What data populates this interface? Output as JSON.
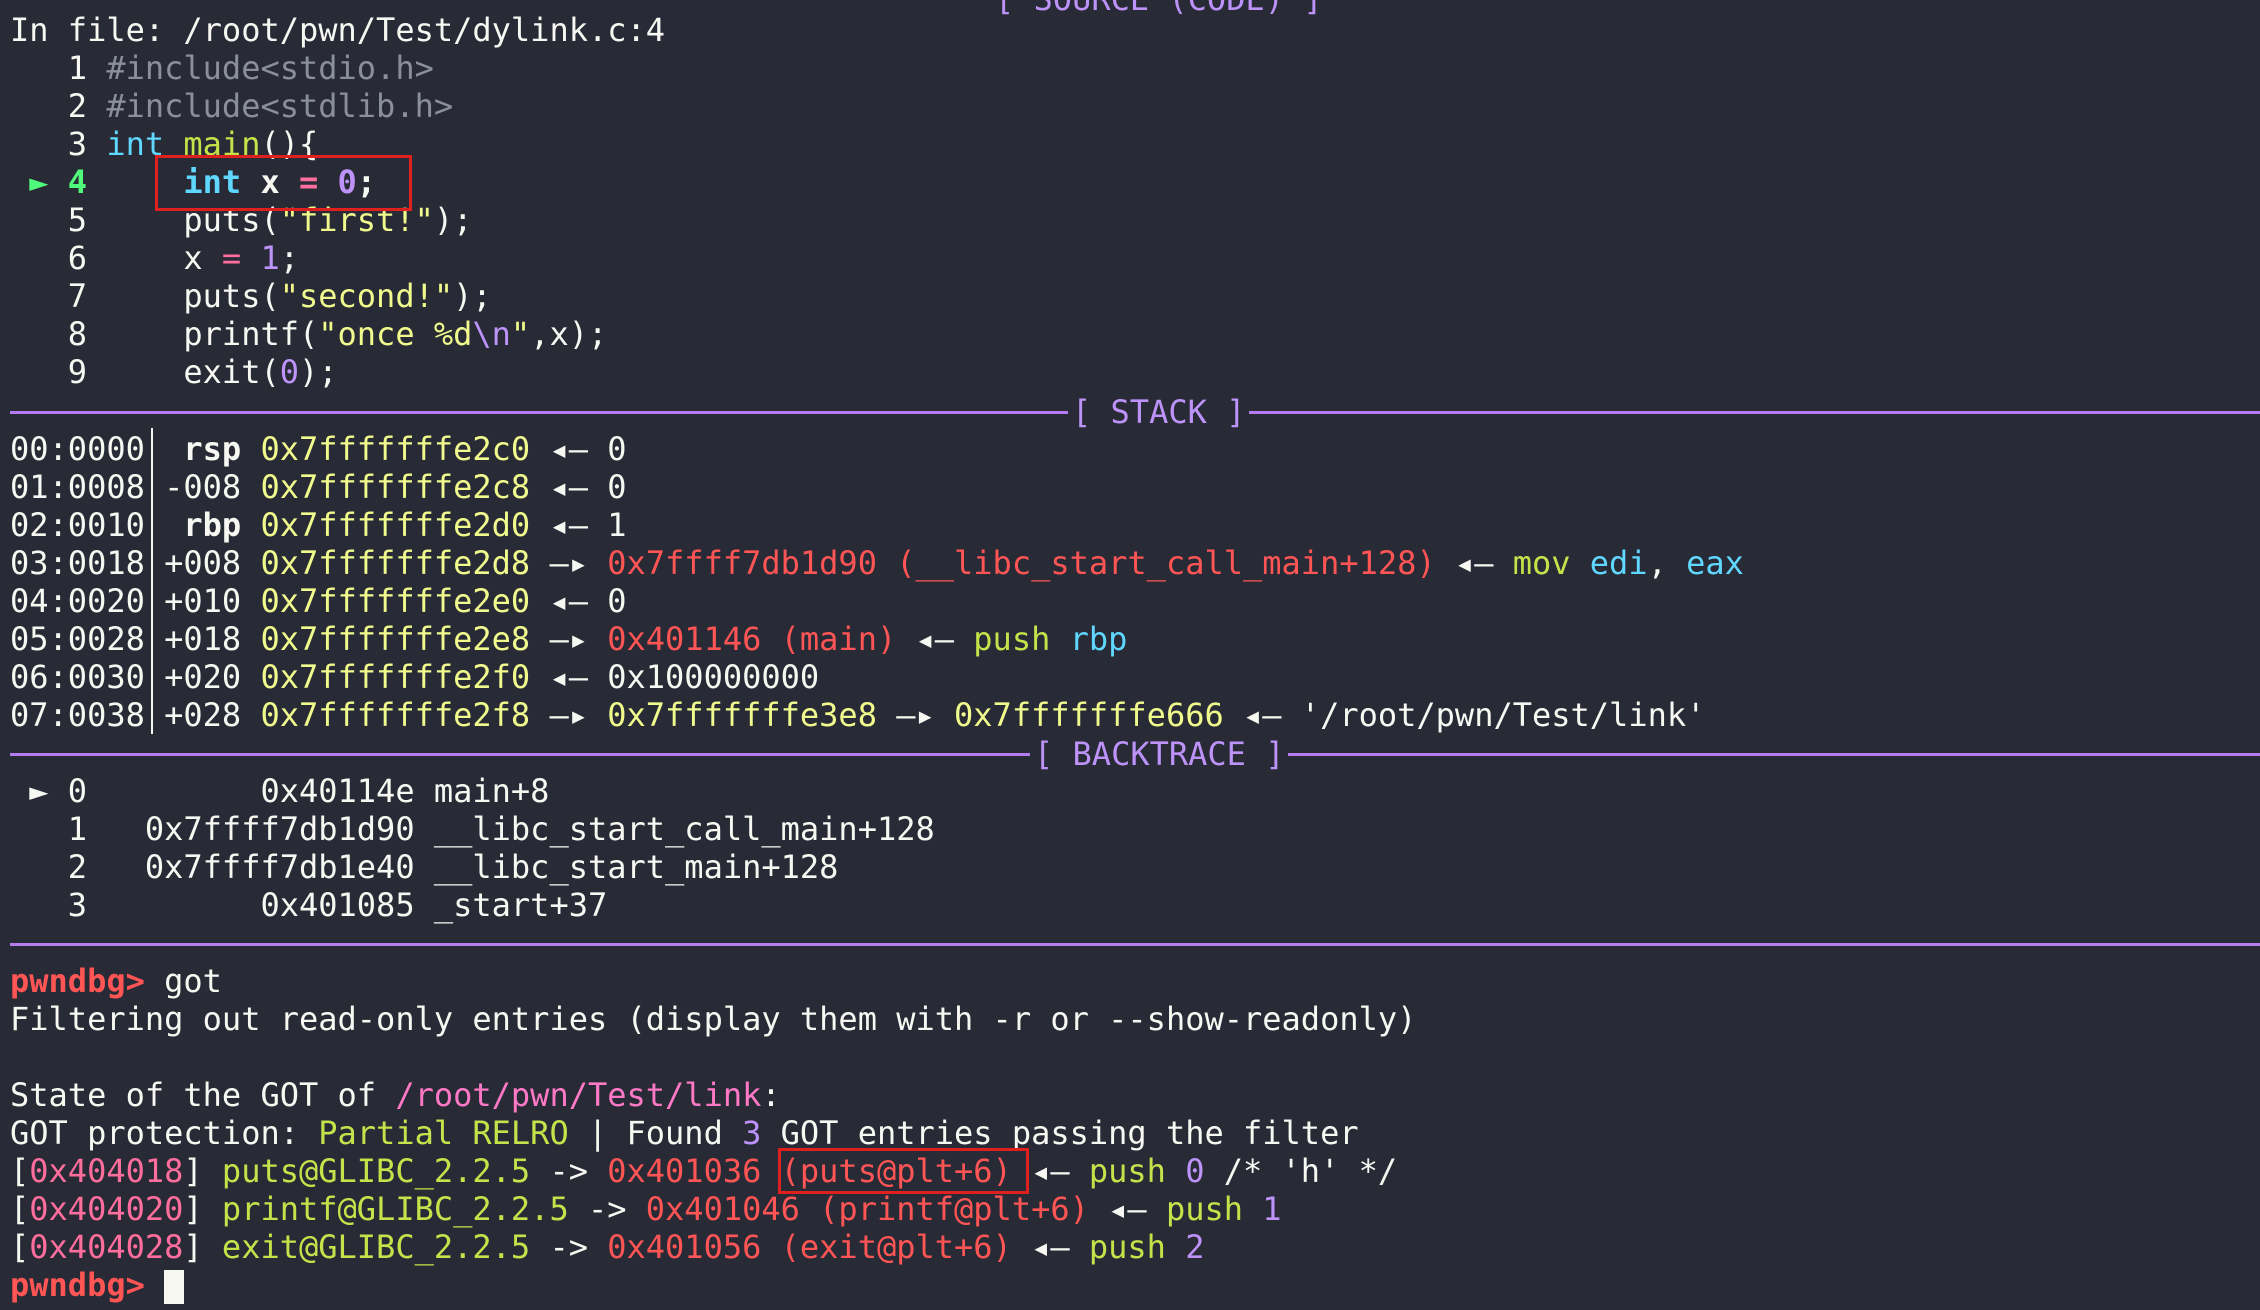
{
  "source": {
    "header_partial": "[ SOURCE (CODE) ]",
    "in_file": "In file: /root/pwn/Test/dylink.c:4",
    "lines": [
      {
        "num": "1",
        "code": "#include<stdio.h>"
      },
      {
        "num": "2",
        "code": "#include<stdlib.h>"
      },
      {
        "num": "3",
        "kw": "int",
        "fn": "main",
        "rest": "(){"
      },
      {
        "num": "4",
        "marker": "►",
        "kw": "int",
        "var": " x ",
        "op": "=",
        "val": " 0",
        "end": ";"
      },
      {
        "num": "5",
        "call": "puts(",
        "str": "\"first!\"",
        "end": ");"
      },
      {
        "num": "6",
        "var": "x ",
        "op": "=",
        "val": " 1",
        "end": ";"
      },
      {
        "num": "7",
        "call": "puts(",
        "str": "\"second!\"",
        "end": ");"
      },
      {
        "num": "8",
        "call": "printf(",
        "str1": "\"once %d",
        "esc": "\\n",
        "str2": "\"",
        "end": ",x);"
      },
      {
        "num": "9",
        "call": "exit(",
        "val": "0",
        "end": ");"
      }
    ]
  },
  "stack": {
    "title": "[ STACK ]",
    "rows": [
      {
        "idx": "00:0000",
        "reg": "rsp",
        "addr": "0x7fffffffe2c0",
        "arrow": "◂—",
        "val": "0"
      },
      {
        "idx": "01:0008",
        "reg": "-008",
        "addr": "0x7fffffffe2c8",
        "arrow": "◂—",
        "val": "0"
      },
      {
        "idx": "02:0010",
        "reg": "rbp",
        "addr": "0x7fffffffe2d0",
        "arrow": "◂—",
        "val": "1"
      },
      {
        "idx": "03:0018",
        "reg": "+008",
        "addr": "0x7fffffffe2d8",
        "arrow": "—▸",
        "target": "0x7ffff7db1d90 (__libc_start_call_main+128)",
        "arrow2": "◂—",
        "ins": "mov",
        "ops1": "edi",
        "comma": ",",
        "ops2": "eax"
      },
      {
        "idx": "04:0020",
        "reg": "+010",
        "addr": "0x7fffffffe2e0",
        "arrow": "◂—",
        "val": "0"
      },
      {
        "idx": "05:0028",
        "reg": "+018",
        "addr": "0x7fffffffe2e8",
        "arrow": "—▸",
        "target": "0x401146 (main)",
        "arrow2": "◂—",
        "ins": "push",
        "ops1": "rbp"
      },
      {
        "idx": "06:0030",
        "reg": "+020",
        "addr": "0x7fffffffe2f0",
        "arrow": "◂—",
        "val": "0x100000000"
      },
      {
        "idx": "07:0038",
        "reg": "+028",
        "addr": "0x7fffffffe2f8",
        "arrow": "—▸",
        "addr2": "0x7fffffffe3e8",
        "arrow2": "—▸",
        "addr3": "0x7fffffffe666",
        "arrow3": "◂—",
        "str": "'/root/pwn/Test/link'"
      }
    ]
  },
  "backtrace": {
    "title": "[ BACKTRACE ]",
    "frames": [
      {
        "marker": "►",
        "num": "0",
        "addr": "0x40114e",
        "sym": "main+8"
      },
      {
        "num": "1",
        "addr": "0x7ffff7db1d90",
        "sym": "__libc_start_call_main+128"
      },
      {
        "num": "2",
        "addr": "0x7ffff7db1e40",
        "sym": "__libc_start_main+128"
      },
      {
        "num": "3",
        "addr": "0x401085",
        "sym": "_start+37"
      }
    ]
  },
  "console": {
    "prompt": "pwndbg>",
    "command": " got",
    "filter_msg": "Filtering out read-only entries (display them with -r or --show-readonly)",
    "state_prefix": "State of the GOT of ",
    "state_path": "/root/pwn/Test/link",
    "state_suffix": ":",
    "prot_prefix": "GOT protection: ",
    "prot_value": "Partial RELRO",
    "prot_mid": " | Found ",
    "prot_count": "3",
    "prot_suffix": " GOT entries passing the filter",
    "entries": [
      {
        "slot": "0x404018",
        "name": "puts@GLIBC_2.2.5",
        "arrow": "->",
        "addr": "0x401036",
        "plt": "(puts@plt+6)",
        "arrow2": "◂—",
        "ins": "push",
        "num": "0",
        "comment": "/* 'h' */"
      },
      {
        "slot": "0x404020",
        "name": "printf@GLIBC_2.2.5",
        "arrow": "->",
        "addr": "0x401046",
        "plt": "(printf@plt+6)",
        "arrow2": "◂—",
        "ins": "push",
        "num": "1"
      },
      {
        "slot": "0x404028",
        "name": "exit@GLIBC_2.2.5",
        "arrow": "->",
        "addr": "0x401056",
        "plt": "(exit@plt+6)",
        "arrow2": "◂—",
        "ins": "push",
        "num": "2"
      }
    ],
    "final_prompt": "pwndbg>"
  },
  "colors": {
    "background": "#282a36",
    "separator": "#b57cf2",
    "highlight_box": "#e0201f",
    "prompt": "#ff5555"
  }
}
